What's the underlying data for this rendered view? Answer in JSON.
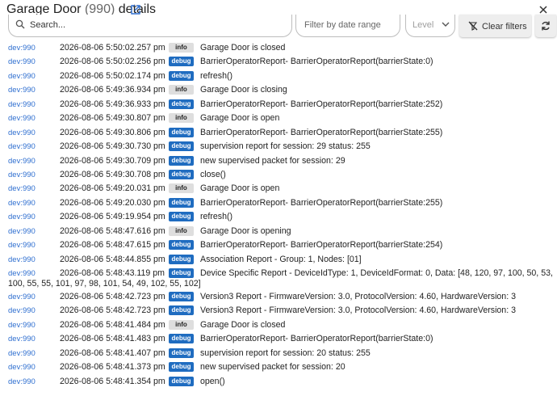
{
  "header": {
    "title_main": "Garage Door",
    "title_count": "(990)",
    "title_suffix": "details"
  },
  "toolbar": {
    "search_placeholder": "Search...",
    "date_placeholder": "Filter by date range",
    "level_placeholder": "Level",
    "clear_label": "Clear filters"
  },
  "log": [
    {
      "dev": "dev:990",
      "time": "2026-08-06 5:50:02.257 pm",
      "level": "info",
      "msg": "Garage Door is closed"
    },
    {
      "dev": "dev:990",
      "time": "2026-08-06 5:50:02.256 pm",
      "level": "debug",
      "msg": "BarrierOperatorReport- BarrierOperatorReport(barrierState:0)"
    },
    {
      "dev": "dev:990",
      "time": "2026-08-06 5:50:02.174 pm",
      "level": "debug",
      "msg": "refresh()"
    },
    {
      "dev": "dev:990",
      "time": "2026-08-06 5:49:36.934 pm",
      "level": "info",
      "msg": "Garage Door is closing"
    },
    {
      "dev": "dev:990",
      "time": "2026-08-06 5:49:36.933 pm",
      "level": "debug",
      "msg": "BarrierOperatorReport- BarrierOperatorReport(barrierState:252)"
    },
    {
      "dev": "dev:990",
      "time": "2026-08-06 5:49:30.807 pm",
      "level": "info",
      "msg": "Garage Door is open"
    },
    {
      "dev": "dev:990",
      "time": "2026-08-06 5:49:30.806 pm",
      "level": "debug",
      "msg": "BarrierOperatorReport- BarrierOperatorReport(barrierState:255)"
    },
    {
      "dev": "dev:990",
      "time": "2026-08-06 5:49:30.730 pm",
      "level": "debug",
      "msg": "supervision report for session: 29 status: 255"
    },
    {
      "dev": "dev:990",
      "time": "2026-08-06 5:49:30.709 pm",
      "level": "debug",
      "msg": "new supervised packet for session: 29"
    },
    {
      "dev": "dev:990",
      "time": "2026-08-06 5:49:30.708 pm",
      "level": "debug",
      "msg": "close()"
    },
    {
      "dev": "dev:990",
      "time": "2026-08-06 5:49:20.031 pm",
      "level": "info",
      "msg": "Garage Door is open"
    },
    {
      "dev": "dev:990",
      "time": "2026-08-06 5:49:20.030 pm",
      "level": "debug",
      "msg": "BarrierOperatorReport- BarrierOperatorReport(barrierState:255)"
    },
    {
      "dev": "dev:990",
      "time": "2026-08-06 5:49:19.954 pm",
      "level": "debug",
      "msg": "refresh()"
    },
    {
      "dev": "dev:990",
      "time": "2026-08-06 5:48:47.616 pm",
      "level": "info",
      "msg": "Garage Door is opening"
    },
    {
      "dev": "dev:990",
      "time": "2026-08-06 5:48:47.615 pm",
      "level": "debug",
      "msg": "BarrierOperatorReport- BarrierOperatorReport(barrierState:254)"
    },
    {
      "dev": "dev:990",
      "time": "2026-08-06 5:48:44.855 pm",
      "level": "debug",
      "msg": "Association Report - Group: 1, Nodes: [01]"
    },
    {
      "dev": "dev:990",
      "time": "2026-08-06 5:48:43.119 pm",
      "level": "debug",
      "msg": "Device Specific Report - DeviceIdType: 1, DeviceIdFormat: 0, Data: [48, 120, 97, 100, 50, 53, 100, 55, 55, 101, 97, 98, 101, 54, 49, 102, 55, 102]",
      "tall": true
    },
    {
      "dev": "dev:990",
      "time": "2026-08-06 5:48:42.723 pm",
      "level": "debug",
      "msg": "Version3 Report - FirmwareVersion: 3.0, ProtocolVersion: 4.60, HardwareVersion: 3"
    },
    {
      "dev": "dev:990",
      "time": "2026-08-06 5:48:42.723 pm",
      "level": "debug",
      "msg": "Version3 Report - FirmwareVersion: 3.0, ProtocolVersion: 4.60, HardwareVersion: 3"
    },
    {
      "dev": "dev:990",
      "time": "2026-08-06 5:48:41.484 pm",
      "level": "info",
      "msg": "Garage Door is closed"
    },
    {
      "dev": "dev:990",
      "time": "2026-08-06 5:48:41.483 pm",
      "level": "debug",
      "msg": "BarrierOperatorReport- BarrierOperatorReport(barrierState:0)"
    },
    {
      "dev": "dev:990",
      "time": "2026-08-06 5:48:41.407 pm",
      "level": "debug",
      "msg": "supervision report for session: 20 status: 255"
    },
    {
      "dev": "dev:990",
      "time": "2026-08-06 5:48:41.373 pm",
      "level": "debug",
      "msg": "new supervised packet for session: 20"
    },
    {
      "dev": "dev:990",
      "time": "2026-08-06 5:48:41.354 pm",
      "level": "debug",
      "msg": "open()"
    }
  ],
  "colors": {
    "link": "#2f6fd0",
    "debug_badge": "#1f6cc0",
    "info_badge": "#dedede"
  }
}
